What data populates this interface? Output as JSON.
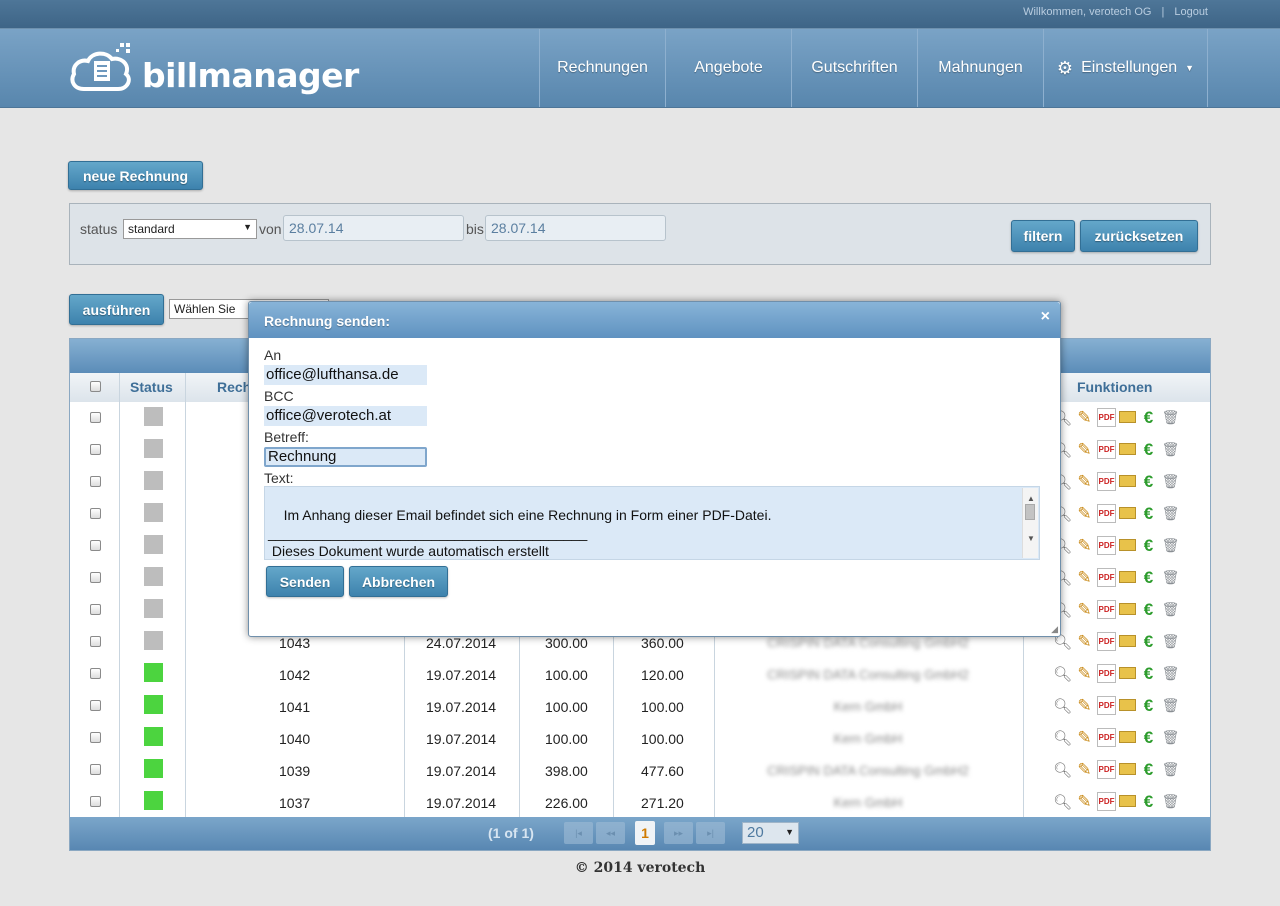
{
  "topbar": {
    "welcome": "Willkommen, verotech OG",
    "separator": "|",
    "logout": "Logout"
  },
  "header": {
    "logo_text": "billmanager",
    "nav": [
      {
        "label": "Rechnungen"
      },
      {
        "label": "Angebote"
      },
      {
        "label": "Gutschriften"
      },
      {
        "label": "Mahnungen"
      },
      {
        "label": "Einstellungen"
      }
    ]
  },
  "toolbar": {
    "new_invoice": "neue Rechnung"
  },
  "filter": {
    "status_label": "status",
    "status_value": "standard",
    "from_label": "von",
    "from_value": "28.07.14",
    "to_label": "bis",
    "to_value": "28.07.14",
    "filter_button": "filtern",
    "reset_button": "zurücksetzen"
  },
  "bulk": {
    "execute_button": "ausführen",
    "action_placeholder": "Wählen Sie"
  },
  "table": {
    "headers": {
      "status": "Status",
      "number_partial": "Rech",
      "functions": "Funktionen"
    },
    "rows": [
      {
        "status": "grey",
        "number": "",
        "date": "",
        "net": "",
        "gross": "",
        "customer": ""
      },
      {
        "status": "grey",
        "number": "",
        "date": "",
        "net": "",
        "gross": "",
        "customer": ""
      },
      {
        "status": "grey",
        "number": "",
        "date": "",
        "net": "",
        "gross": "",
        "customer": ""
      },
      {
        "status": "grey",
        "number": "",
        "date": "",
        "net": "",
        "gross": "",
        "customer": ""
      },
      {
        "status": "grey",
        "number": "",
        "date": "",
        "net": "",
        "gross": "",
        "customer": ""
      },
      {
        "status": "grey",
        "number": "",
        "date": "",
        "net": "",
        "gross": "",
        "customer": ""
      },
      {
        "status": "grey",
        "number": "",
        "date": "",
        "net": "",
        "gross": "",
        "customer": ""
      },
      {
        "status": "grey",
        "number": "1043",
        "date": "24.07.2014",
        "net": "300.00",
        "gross": "360.00",
        "customer": "CRISPIN DATA Consulting GmbH2"
      },
      {
        "status": "green",
        "number": "1042",
        "date": "19.07.2014",
        "net": "100.00",
        "gross": "120.00",
        "customer": "CRISPIN DATA Consulting GmbH2"
      },
      {
        "status": "green",
        "number": "1041",
        "date": "19.07.2014",
        "net": "100.00",
        "gross": "100.00",
        "customer": "Kern GmbH"
      },
      {
        "status": "green",
        "number": "1040",
        "date": "19.07.2014",
        "net": "100.00",
        "gross": "100.00",
        "customer": "Kern GmbH"
      },
      {
        "status": "green",
        "number": "1039",
        "date": "19.07.2014",
        "net": "398.00",
        "gross": "477.60",
        "customer": "CRISPIN DATA Consulting GmbH2"
      },
      {
        "status": "green",
        "number": "1037",
        "date": "19.07.2014",
        "net": "226.00",
        "gross": "271.20",
        "customer": "Kern GmbH"
      }
    ],
    "status_colors": {
      "grey": "#bdbdbd",
      "green": "#4cd43f"
    }
  },
  "pager": {
    "info": "(1 of 1)",
    "current": "1",
    "page_size": "20"
  },
  "footer": {
    "copyright": "© 2014 verotech"
  },
  "modal": {
    "title": "Rechnung senden:",
    "close": "×",
    "to_label": "An",
    "to_value": "office@lufthansa.de",
    "bcc_label": "BCC",
    "bcc_value": "office@verotech.at",
    "subject_label": "Betreff:",
    "subject_value": "Rechnung",
    "text_label": "Text:",
    "text_value": "Im Anhang dieser Email befindet sich eine Rechnung in Form einer PDF-Datei.\n_________________________________________\n Dieses Dokument wurde automatisch erstellt\n und ist mit Zustellung per Email gültig.",
    "send_button": "Senden",
    "cancel_button": "Abbrechen"
  }
}
